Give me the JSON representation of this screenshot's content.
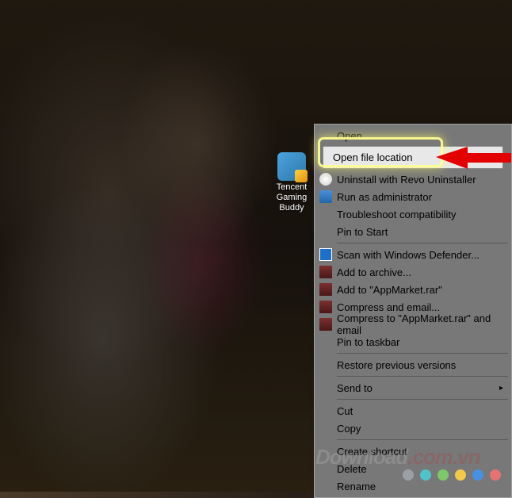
{
  "desktop_icon": {
    "label": "Tencent Gaming Buddy"
  },
  "context_menu": {
    "open": "Open",
    "open_file_location": "Open file location",
    "uninstall_revo": "Uninstall with Revo Uninstaller",
    "run_as_admin": "Run as administrator",
    "troubleshoot": "Troubleshoot compatibility",
    "pin_start": "Pin to Start",
    "scan_defender": "Scan with Windows Defender...",
    "add_archive": "Add to archive...",
    "add_appmarket": "Add to \"AppMarket.rar\"",
    "compress_email": "Compress and email...",
    "compress_appmarket_email": "Compress to \"AppMarket.rar\" and email",
    "pin_taskbar": "Pin to taskbar",
    "restore_versions": "Restore previous versions",
    "send_to": "Send to",
    "cut": "Cut",
    "copy": "Copy",
    "create_shortcut": "Create shortcut",
    "delete": "Delete",
    "rename": "Rename"
  },
  "watermark": {
    "text1": "Download",
    "text2": ".com.vn"
  },
  "dots": {
    "colors": [
      "#9aa0a6",
      "#4fc3c9",
      "#7cc86a",
      "#f2c94c",
      "#4a90e2",
      "#e57373"
    ]
  }
}
